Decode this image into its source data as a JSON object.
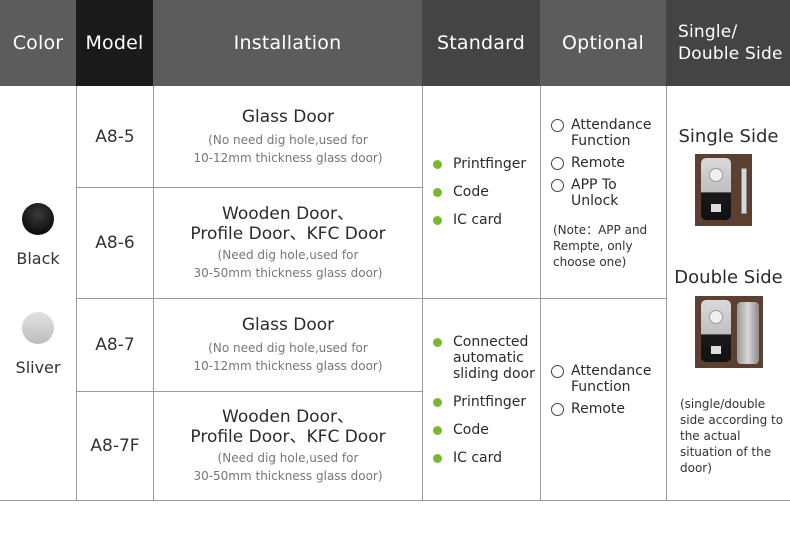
{
  "header": {
    "color": "Color",
    "model": "Model",
    "installation": "Installation",
    "standard": "Standard",
    "optional": "Optional",
    "side_line1": "Single/",
    "side_line2": "Double Side"
  },
  "colors": [
    {
      "label": "Black",
      "swatch": "#111111"
    },
    {
      "label": "Sliver",
      "swatch": "#cfcfcf"
    }
  ],
  "rows": [
    {
      "model": "A8-5",
      "install_title_lines": [
        "Glass Door"
      ],
      "install_note_lines": [
        "(No need dig hole,used for",
        "10-12mm thickness glass door)"
      ]
    },
    {
      "model": "A8-6",
      "install_title_lines": [
        "Wooden Door、",
        "Profile Door、KFC Door"
      ],
      "install_note_lines": [
        "(Need dig hole,used for",
        "30-50mm thickness glass door)"
      ]
    },
    {
      "model": "A8-7",
      "install_title_lines": [
        "Glass Door"
      ],
      "install_note_lines": [
        "(No need dig hole,used for",
        "10-12mm thickness glass door)"
      ]
    },
    {
      "model": "A8-7F",
      "install_title_lines": [
        "Wooden Door、",
        "Profile Door、KFC Door"
      ],
      "install_note_lines": [
        "(Need dig hole,used for",
        "30-50mm thickness glass door)"
      ]
    }
  ],
  "standard": {
    "group1": [
      "Printfinger",
      "Code",
      "IC card"
    ],
    "group2": [
      "Connected automatic sliding door",
      "Printfinger",
      "Code",
      "IC card"
    ]
  },
  "optional": {
    "group1": [
      "Attendance Function",
      "Remote",
      "APP To Unlock"
    ],
    "group1_note": "(Note：APP and Rempte, only choose one)",
    "group2": [
      "Attendance Function",
      "Remote"
    ]
  },
  "side": {
    "single_label": "Single Side",
    "double_label": "Double Side",
    "note": "(single/double side according to the actual situation of the door)"
  },
  "accent": {
    "bullet_green": "#7cb82f",
    "header_gray": "#5c5c5c",
    "header_dark": "#444444",
    "header_black": "#1a1a1a"
  }
}
